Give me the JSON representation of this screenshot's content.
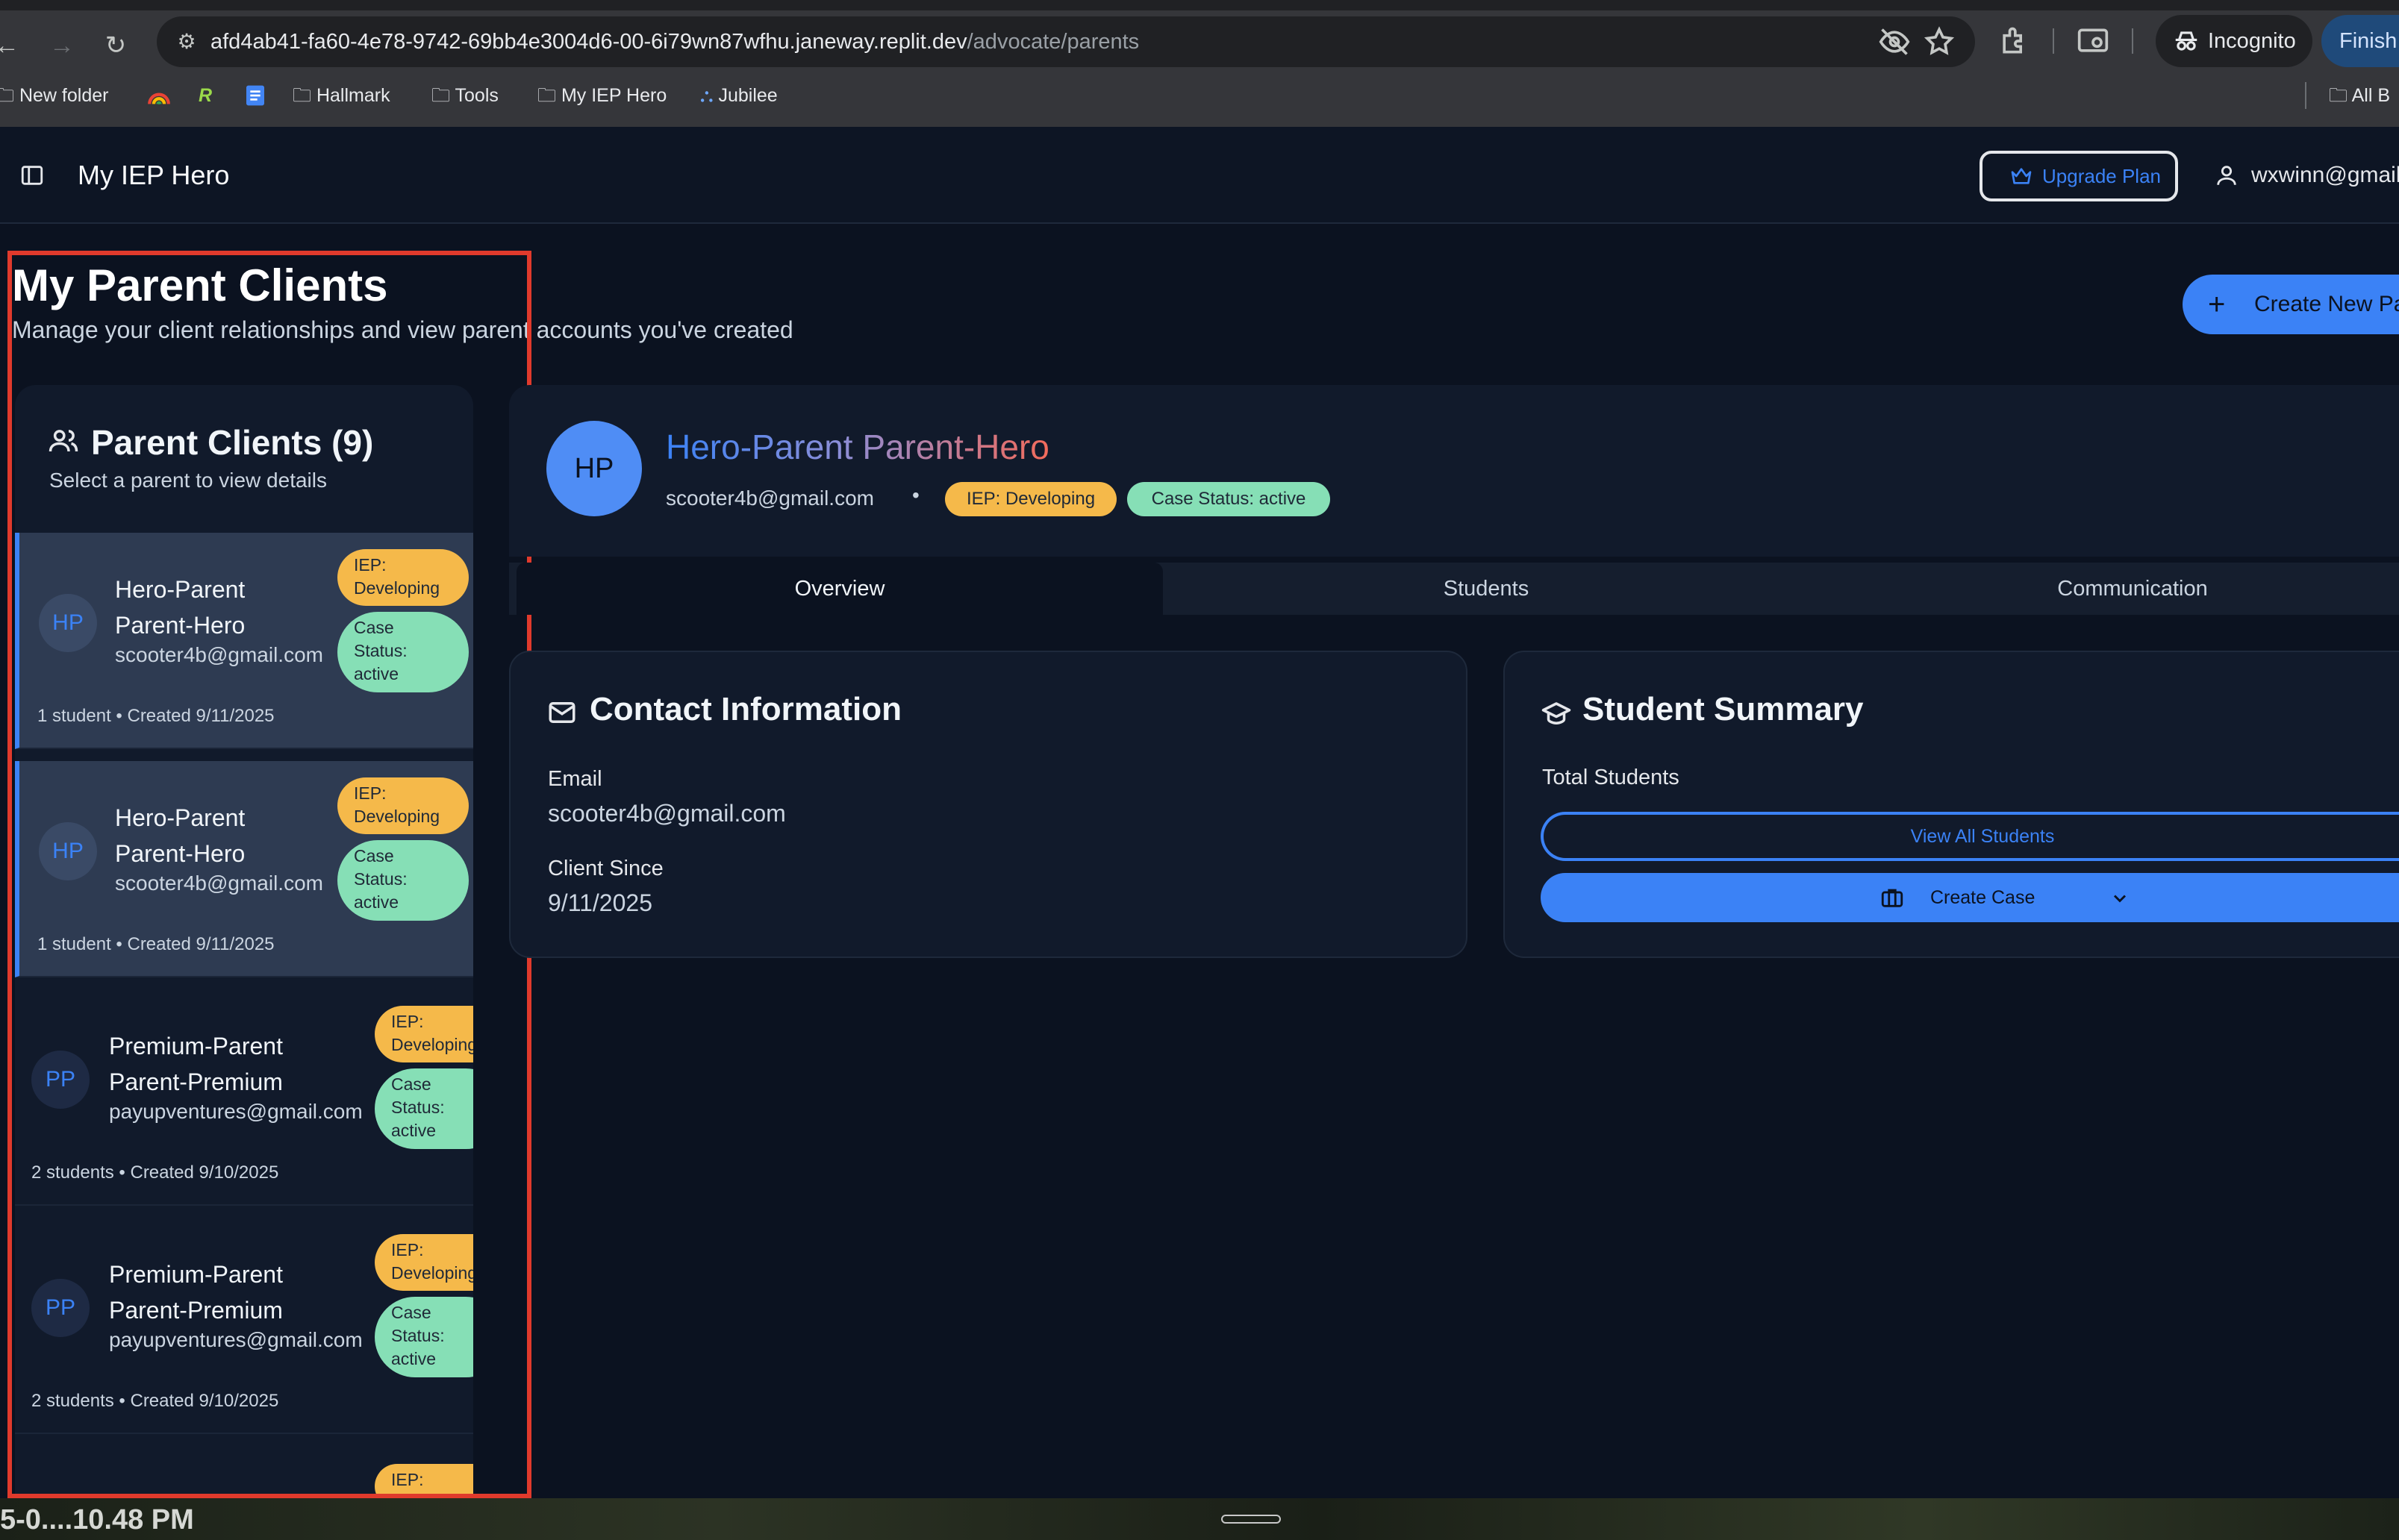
{
  "browser": {
    "url_host": "afd4ab41-fa60-4e78-9742-69bb4e3004d6-00-6i79wn87wfhu.janeway.replit.dev",
    "url_path": "/advocate/parents",
    "incognito_label": "Incognito",
    "finish_label": "Finish u",
    "bookmarks": [
      "New folder",
      "Hallmark",
      "Tools",
      "My IEP Hero",
      "Jubilee",
      "All B"
    ]
  },
  "app": {
    "title": "My IEP Hero",
    "upgrade_label": "Upgrade Plan",
    "user_email": "wxwinn@gmail"
  },
  "page": {
    "title": "My Parent Clients",
    "subtitle": "Manage your client relationships and view parent accounts you've created",
    "create_new_label": "Create New Pa"
  },
  "client_list": {
    "title": "Parent Clients (9)",
    "subtitle": "Select a parent to view details",
    "clients": [
      {
        "initials": "HP",
        "name_line1": "Hero-Parent",
        "name_line2": "Parent-Hero",
        "email": "scooter4b@gmail.com",
        "iep_line1": "IEP:",
        "iep_line2": "Developing",
        "case_line1": "Case",
        "case_line2": "Status:",
        "case_line3": "active",
        "meta": "1 student • Created 9/11/2025"
      },
      {
        "initials": "HP",
        "name_line1": "Hero-Parent",
        "name_line2": "Parent-Hero",
        "email": "scooter4b@gmail.com",
        "iep_line1": "IEP:",
        "iep_line2": "Developing",
        "case_line1": "Case",
        "case_line2": "Status:",
        "case_line3": "active",
        "meta": "1 student • Created 9/11/2025"
      },
      {
        "initials": "PP",
        "name_line1": "Premium-Parent",
        "name_line2": "Parent-Premium",
        "email": "payupventures@gmail.com",
        "iep_line1": "IEP:",
        "iep_line2": "Developing",
        "case_line1": "Case",
        "case_line2": "Status:",
        "case_line3": "active",
        "meta": "2 students • Created 9/10/2025"
      },
      {
        "initials": "PP",
        "name_line1": "Premium-Parent",
        "name_line2": "Parent-Premium",
        "email": "payupventures@gmail.com",
        "iep_line1": "IEP:",
        "iep_line2": "Developing",
        "case_line1": "Case",
        "case_line2": "Status:",
        "case_line3": "active",
        "meta": "2 students • Created 9/10/2025"
      }
    ],
    "partial_badge": "IEP:"
  },
  "detail": {
    "initials": "HP",
    "name": "Hero-Parent Parent-Hero",
    "email": "scooter4b@gmail.com",
    "separator": "•",
    "iep_badge": "IEP: Developing",
    "case_badge": "Case Status: active",
    "tabs": [
      "Overview",
      "Students",
      "Communication"
    ],
    "contact": {
      "title": "Contact Information",
      "email_label": "Email",
      "email_value": "scooter4b@gmail.com",
      "since_label": "Client Since",
      "since_value": "9/11/2025"
    },
    "summary": {
      "title": "Student Summary",
      "total_label": "Total Students",
      "view_all_label": "View All Students",
      "create_case_label": "Create Case"
    }
  },
  "bottom": {
    "timestamp": "5-0....10.48 PM"
  },
  "colors": {
    "accent": "#3b82f6",
    "iep_badge": "#f5b94a",
    "case_badge": "#86dfb6",
    "highlight": "#e03a2c"
  }
}
